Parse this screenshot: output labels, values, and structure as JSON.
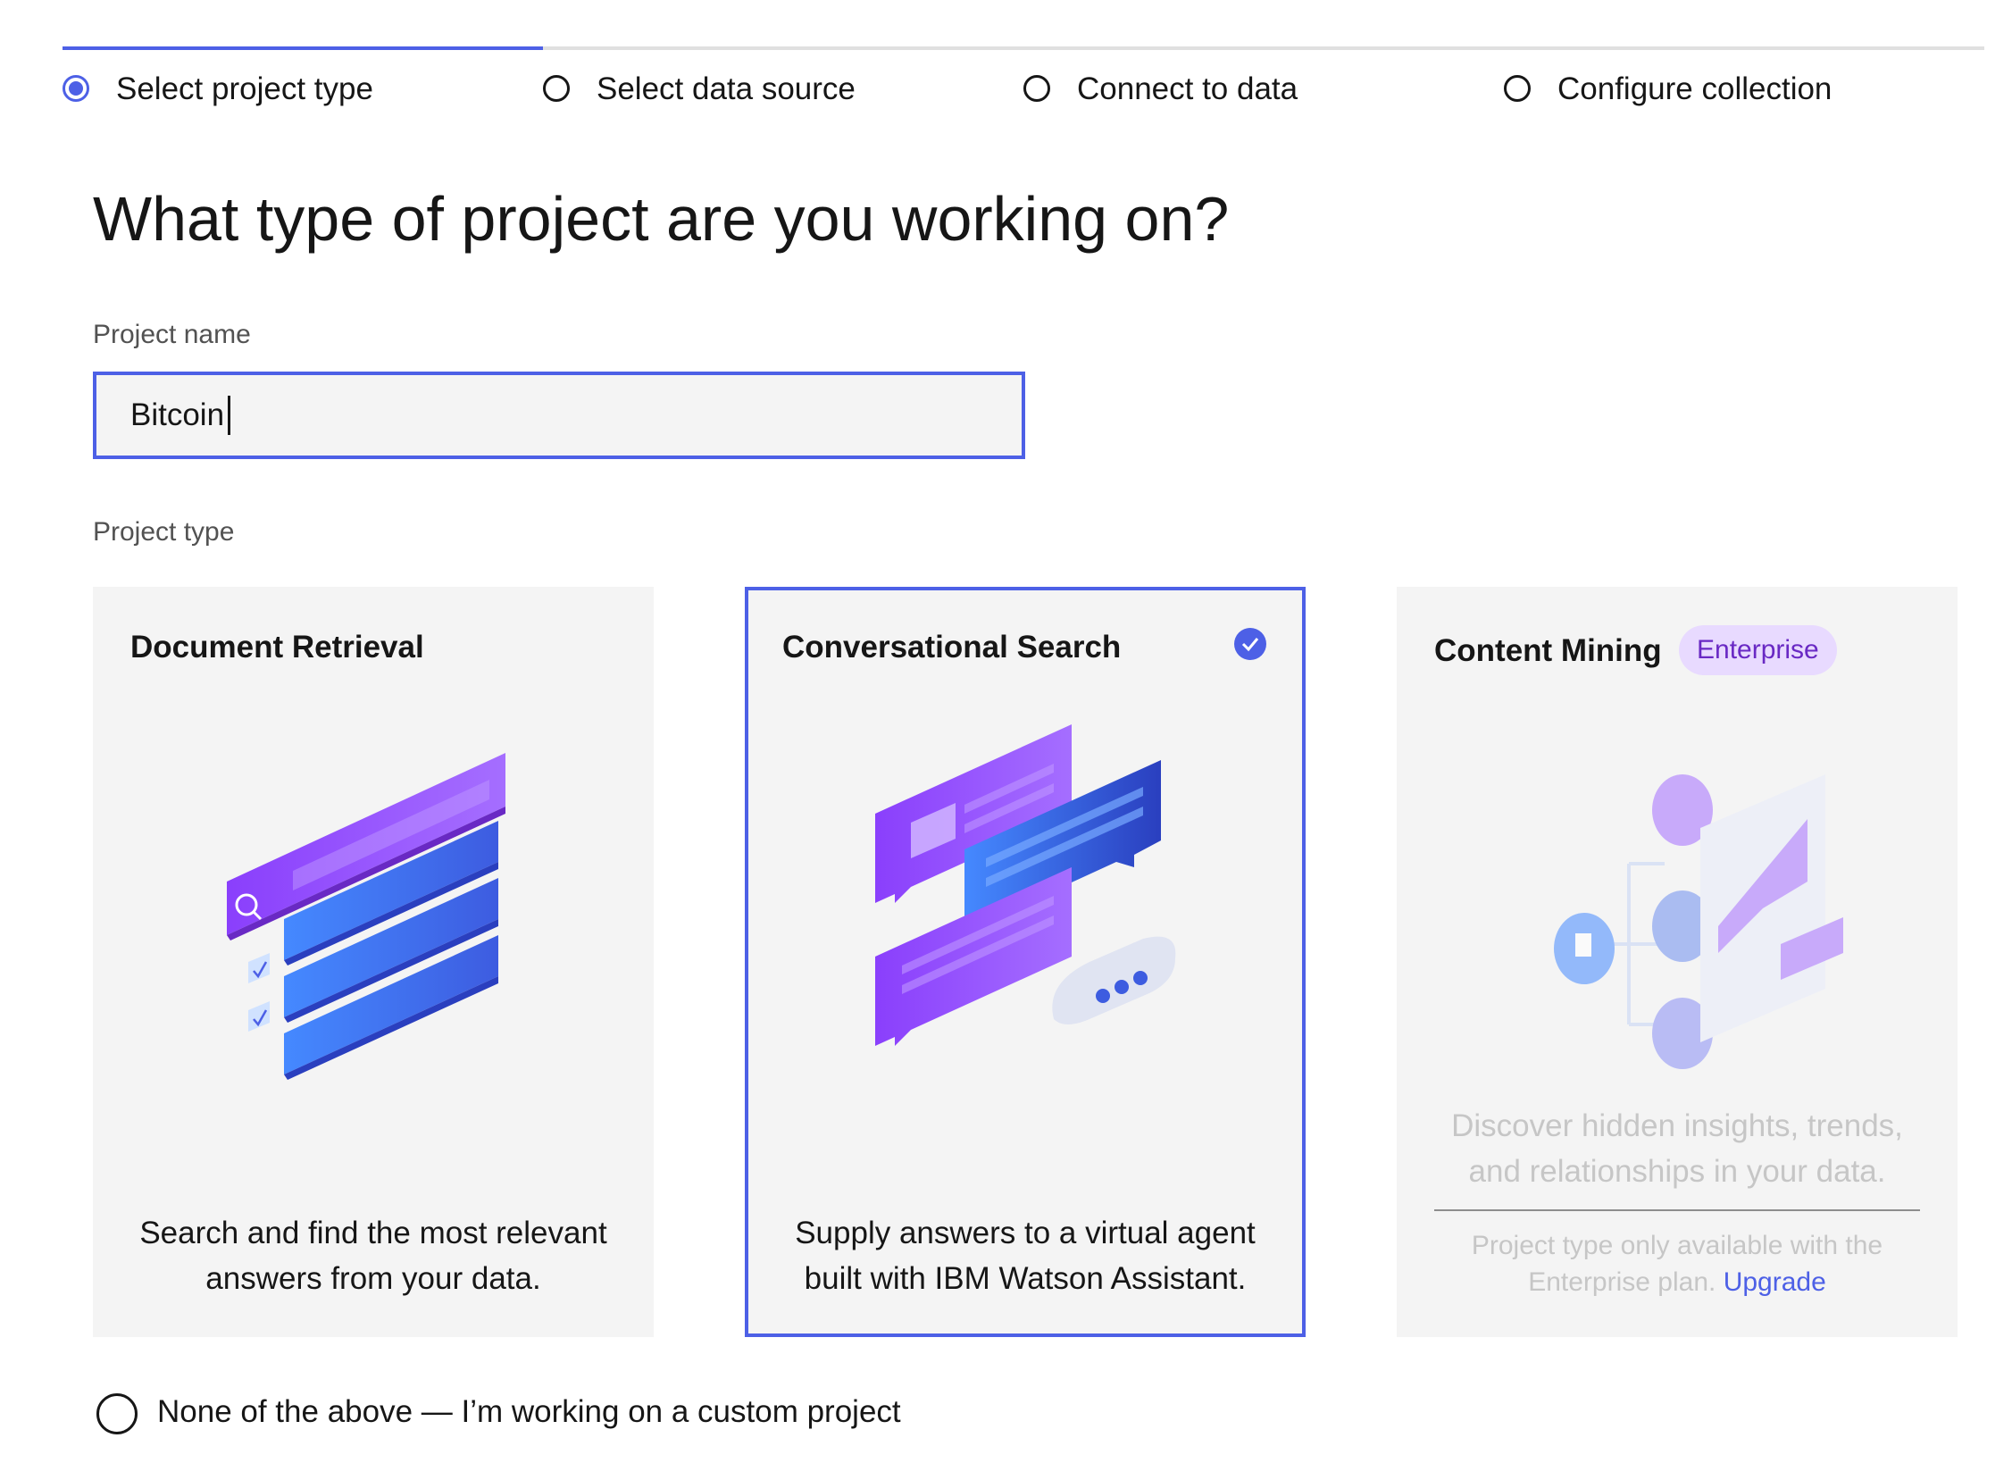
{
  "steps": [
    {
      "label": "Select project type",
      "active": true
    },
    {
      "label": "Select data source",
      "active": false
    },
    {
      "label": "Connect to data",
      "active": false
    },
    {
      "label": "Configure collection",
      "active": false
    }
  ],
  "heading": "What type of project are you working on?",
  "project_name": {
    "label": "Project name",
    "value": "Bitcoin"
  },
  "project_type": {
    "label": "Project type",
    "cards": [
      {
        "title": "Document Retrieval",
        "description": "Search and find the most relevant answers from your data.",
        "selected": false
      },
      {
        "title": "Conversational Search",
        "description": "Supply answers to a virtual agent built with IBM Watson Assistant.",
        "selected": true
      },
      {
        "title": "Content Mining",
        "badge": "Enterprise",
        "description": "Discover hidden insights, trends, and relationships in your data.",
        "note": "Project type only available with the Enterprise plan.",
        "link": "Upgrade",
        "disabled": true
      }
    ]
  },
  "custom_option": "None of the above — I’m working on a custom project",
  "colors": {
    "accent": "#4d60e6",
    "badge_bg": "#e8daff",
    "badge_text": "#6929c4",
    "card_bg": "#f4f4f4"
  },
  "icons": [
    "radio-selected-icon",
    "radio-empty-icon",
    "checkmark-filled-icon",
    "search-icon",
    "checkbox-icon",
    "chat-bubble-icon",
    "typing-indicator-icon",
    "document-icon"
  ]
}
